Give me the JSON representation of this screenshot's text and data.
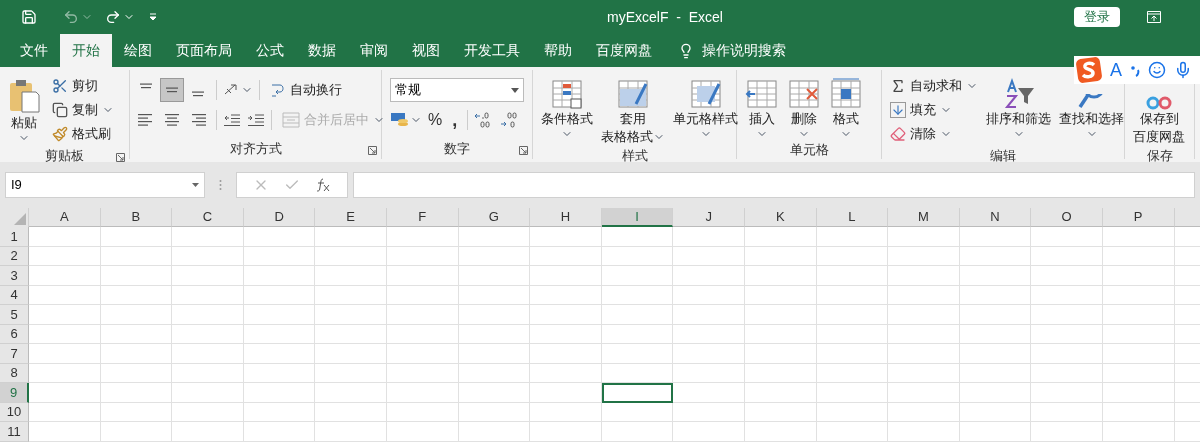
{
  "title_bar": {
    "title": "myExcelF  -  Excel",
    "login_button": "登录"
  },
  "tabs": [
    {
      "label": "文件",
      "selected": false
    },
    {
      "label": "开始",
      "selected": true
    },
    {
      "label": "绘图",
      "selected": false
    },
    {
      "label": "页面布局",
      "selected": false
    },
    {
      "label": "公式",
      "selected": false
    },
    {
      "label": "数据",
      "selected": false
    },
    {
      "label": "审阅",
      "selected": false
    },
    {
      "label": "视图",
      "selected": false
    },
    {
      "label": "开发工具",
      "selected": false
    },
    {
      "label": "帮助",
      "selected": false
    },
    {
      "label": "百度网盘",
      "selected": false
    }
  ],
  "tell_me": "操作说明搜索",
  "ime_bar": {
    "mode": "A"
  },
  "clipboard": {
    "label": "剪贴板",
    "paste": "粘贴",
    "items": [
      "剪切",
      "复制",
      "格式刷"
    ]
  },
  "alignment": {
    "label": "对齐方式",
    "vertical": [
      {
        "selected": false
      },
      {
        "selected": true
      },
      {
        "selected": false
      }
    ],
    "horizontal": [
      {
        "selected": false
      },
      {
        "selected": false
      },
      {
        "selected": false
      }
    ],
    "wrap_text": "自动换行",
    "merge": {
      "label": "合并后居中",
      "disabled": true
    }
  },
  "number": {
    "label": "数字",
    "format": "常规",
    "percent": "%",
    "comma": ","
  },
  "styles": {
    "label": "样式",
    "items": [
      {
        "lines": [
          "条件格式"
        ]
      },
      {
        "lines": [
          "套用",
          "表格格式"
        ]
      },
      {
        "lines": [
          "单元格样式"
        ]
      }
    ]
  },
  "cells": {
    "label": "单元格",
    "items": [
      "插入",
      "删除",
      "格式"
    ]
  },
  "editing": {
    "label": "编辑",
    "small": [
      "自动求和",
      "填充",
      "清除"
    ],
    "large": [
      "排序和筛选",
      "查找和选择"
    ]
  },
  "save": {
    "label": "保存",
    "lines": [
      "保存到",
      "百度网盘"
    ]
  },
  "formula_bar": {
    "name_box": "I9"
  },
  "columns": [
    {
      "label": "A",
      "selected": false
    },
    {
      "label": "B",
      "selected": false
    },
    {
      "label": "C",
      "selected": false
    },
    {
      "label": "D",
      "selected": false
    },
    {
      "label": "E",
      "selected": false
    },
    {
      "label": "F",
      "selected": false
    },
    {
      "label": "G",
      "selected": false
    },
    {
      "label": "H",
      "selected": false
    },
    {
      "label": "I",
      "selected": true
    },
    {
      "label": "J",
      "selected": false
    },
    {
      "label": "K",
      "selected": false
    },
    {
      "label": "L",
      "selected": false
    },
    {
      "label": "M",
      "selected": false
    },
    {
      "label": "N",
      "selected": false
    },
    {
      "label": "O",
      "selected": false
    },
    {
      "label": "P",
      "selected": false
    }
  ],
  "rows": [
    {
      "label": "1",
      "selected": false
    },
    {
      "label": "2",
      "selected": false
    },
    {
      "label": "3",
      "selected": false
    },
    {
      "label": "4",
      "selected": false
    },
    {
      "label": "5",
      "selected": false
    },
    {
      "label": "6",
      "selected": false
    },
    {
      "label": "7",
      "selected": false
    },
    {
      "label": "8",
      "selected": false
    },
    {
      "label": "9",
      "selected": true
    },
    {
      "label": "10",
      "selected": false
    },
    {
      "label": "11",
      "selected": false
    }
  ]
}
